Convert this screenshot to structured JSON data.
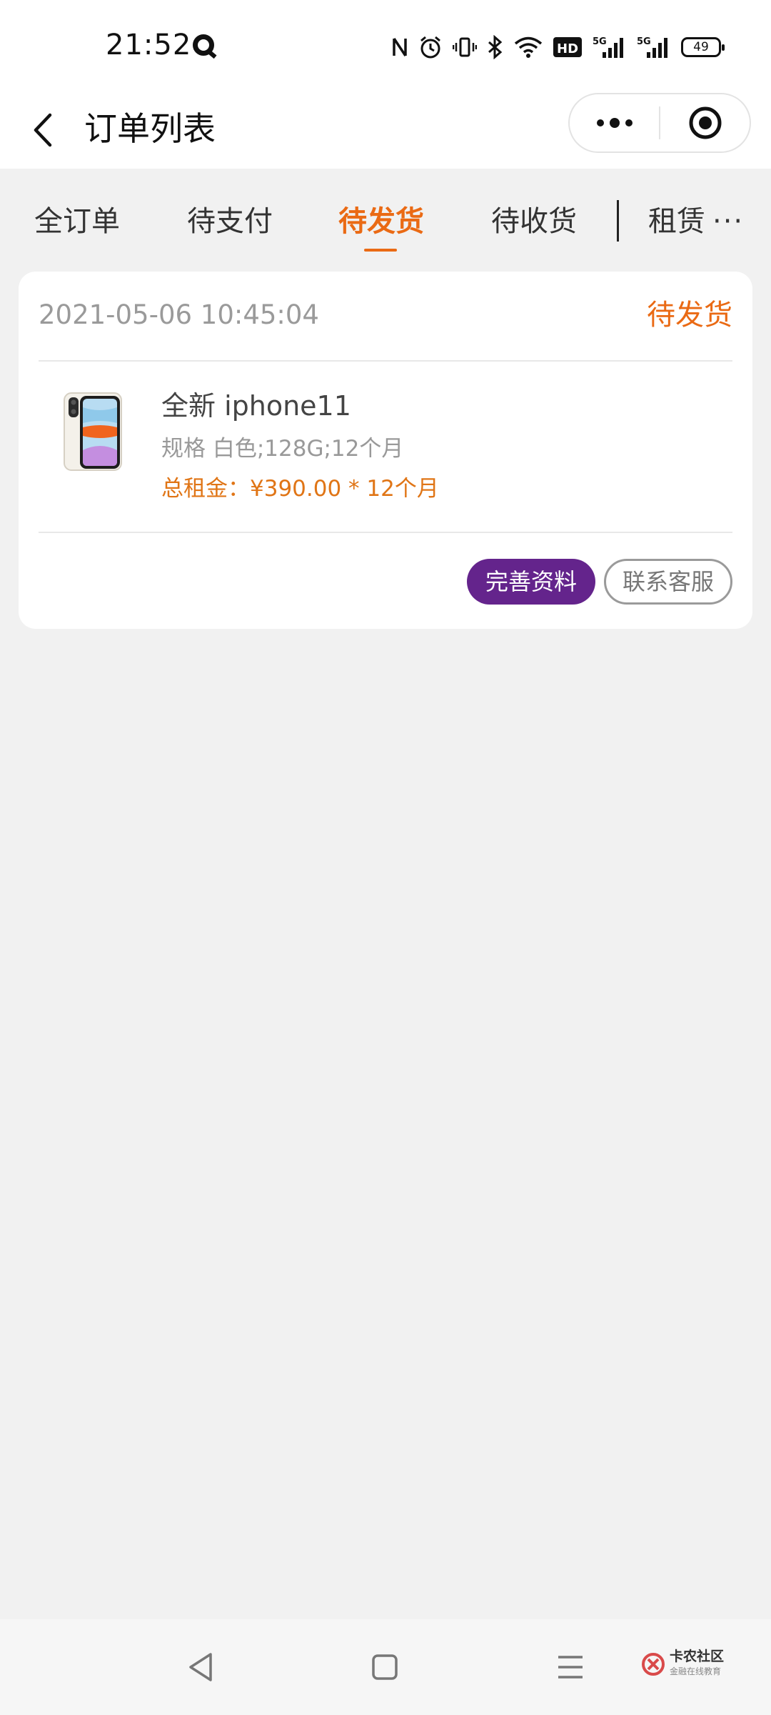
{
  "status_bar": {
    "time": "21:52",
    "battery": "49",
    "icons": [
      "app-q-icon",
      "nfc-icon",
      "alarm-icon",
      "vibrate-icon",
      "bluetooth-icon",
      "wifi-icon",
      "hd-icon",
      "signal-5g-icon",
      "signal-5g-icon",
      "battery-icon"
    ],
    "hd_label": "HD",
    "network_label": "5G"
  },
  "navbar": {
    "title": "订单列表"
  },
  "tabs": {
    "items": [
      {
        "label": "全订单",
        "active": false
      },
      {
        "label": "待支付",
        "active": false
      },
      {
        "label": "待发货",
        "active": true
      },
      {
        "label": "待收货",
        "active": false
      },
      {
        "label": "租赁",
        "active": false
      }
    ],
    "more": "···"
  },
  "order": {
    "time": "2021-05-06 10:45:04",
    "status": "待发货",
    "product_name": "全新 iphone11",
    "spec": "规格 白色;128G;12个月",
    "rent": "总租金：¥390.00 * 12个月",
    "buttons": {
      "complete": "完善资料",
      "contact": "联系客服"
    }
  },
  "colors": {
    "accent": "#ea6a14",
    "primary_button": "#64248c",
    "background": "#f1f1f1"
  },
  "watermark": {
    "title": "卡农社区",
    "subtitle": "金融在线教育"
  }
}
